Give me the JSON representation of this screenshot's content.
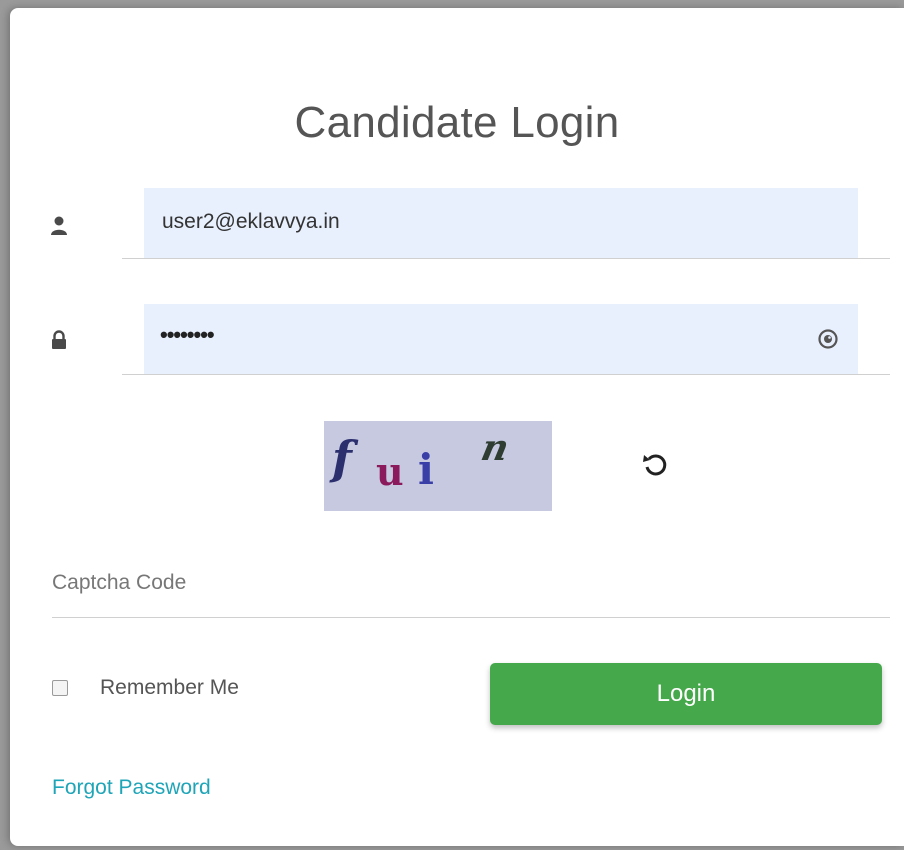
{
  "login_form": {
    "title": "Candidate Login",
    "username": {
      "value": "user2@eklavvya.in",
      "icon": "user-icon"
    },
    "password": {
      "masked_value": "••••••••",
      "icon": "lock-icon",
      "toggle_icon": "eye-icon"
    },
    "captcha": {
      "characters": [
        "f",
        "u",
        "i",
        "n"
      ],
      "refresh_icon": "refresh-icon"
    },
    "captcha_code": {
      "placeholder": "Captcha Code",
      "value": ""
    },
    "remember_me": {
      "label": "Remember Me",
      "checked": false
    },
    "login_button": {
      "label": "Login"
    },
    "forgot_password": {
      "label": "Forgot Password"
    }
  },
  "colors": {
    "field_background": "#e8f0fe",
    "login_button": "#45a84b",
    "link": "#1fa5b8",
    "captcha_background": "#c6c9e0"
  }
}
